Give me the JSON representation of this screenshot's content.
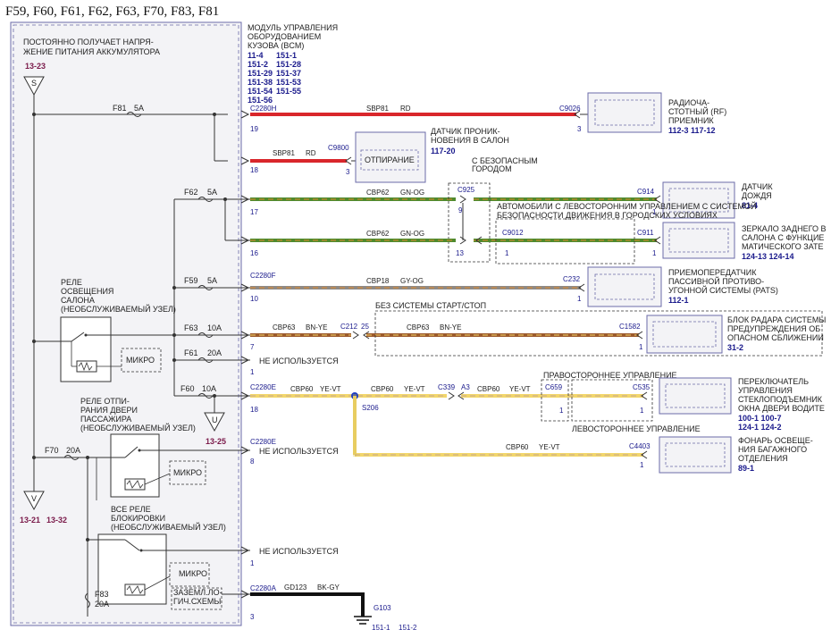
{
  "title": "F59, F60, F61, F62, F63, F70, F83, F81",
  "battery_note": "ПОСТОЯННО ПОЛУЧАЕТ НАПРЯ-\nЖЕНИЕ ПИТАНИЯ АККУМУЛЯТОРА",
  "battery_ref": "13-23",
  "battery_symbol": "S",
  "bcm": {
    "label": "МОДУЛЬ УПРАВЛЕНИЯ\nОБОРУДОВАНИЕМ\nКУЗОВА (BCM)",
    "refs": [
      [
        "11-4",
        "151-1"
      ],
      [
        "151-2",
        "151-28"
      ],
      [
        "151-29",
        "151-37"
      ],
      [
        "151-38",
        "151-53"
      ],
      [
        "151-54",
        "151-55"
      ],
      [
        "151-56",
        ""
      ]
    ]
  },
  "fuses": {
    "f81": {
      "name": "F81",
      "amp": "5A"
    },
    "f62": {
      "name": "F62",
      "amp": "5A"
    },
    "f59": {
      "name": "F59",
      "amp": "5A"
    },
    "f63": {
      "name": "F63",
      "amp": "10A"
    },
    "f61": {
      "name": "F61",
      "amp": "20A"
    },
    "f60": {
      "name": "F60",
      "amp": "10A"
    },
    "f70": {
      "name": "F70",
      "amp": "20A"
    },
    "f83": {
      "name": "F83",
      "amp": "20A"
    }
  },
  "connectors": {
    "c2280h": "C2280H",
    "c2280f": "C2280F",
    "c2280e": "C2280E",
    "c2280e2": "C2280E",
    "c2280a": "C2280A",
    "c9026": "C9026",
    "c9800": "C9800",
    "c925": "C925",
    "c914": "C914",
    "c9012": "C9012",
    "c911": "C911",
    "c232": "C232",
    "c212": "C212",
    "c212pin": "25",
    "c1582": "C1582",
    "c339": "C339",
    "c339pin": "A3",
    "c659": "C659",
    "c535": "C535",
    "c4403": "C4403",
    "s206": "S206",
    "g103": "G103"
  },
  "pins": {
    "p19": "19",
    "p18": "18",
    "p17": "17",
    "p16": "16",
    "p10": "10",
    "p7": "7",
    "p1a": "1",
    "p18b": "18",
    "p8": "8",
    "p1b": "1",
    "p3": "3",
    "c9026": "3",
    "c9800": "3",
    "c925a": "9",
    "c925b": "13",
    "c9012": "1",
    "c914": "1",
    "c911": "1",
    "c232": "1",
    "c1582": "1",
    "c659": "1",
    "c535": "1",
    "c4403": "1"
  },
  "wires": {
    "w1": {
      "circuit": "SBP81",
      "color": "RD"
    },
    "w2": {
      "circuit": "SBP81",
      "color": "RD"
    },
    "w3": {
      "circuit": "CBP62",
      "color": "GN-OG"
    },
    "w4": {
      "circuit": "CBP62",
      "color": "GN-OG"
    },
    "w5": {
      "circuit": "CBP18",
      "color": "GY-OG"
    },
    "w6a": {
      "circuit": "CBP63",
      "color": "BN-YE"
    },
    "w6b": {
      "circuit": "CBP63",
      "color": "BN-YE"
    },
    "w7a": {
      "circuit": "CBP60",
      "color": "YE-VT"
    },
    "w7b": {
      "circuit": "CBP60",
      "color": "YE-VT"
    },
    "w7c": {
      "circuit": "CBP60",
      "color": "YE-VT"
    },
    "w8": {
      "circuit": "CBP60",
      "color": "YE-VT"
    },
    "w9": {
      "circuit": "GD123",
      "color": "BK-GY"
    }
  },
  "not_used": "НЕ ИСПОЛЬЗУЕТСЯ",
  "unlock": "ОТПИРАНИЕ",
  "micro": "МИКРО",
  "ground_logic": "ЗАЗЕМЛ.ЛО-\nГИЧ.СХЕМЫ",
  "ground_refs": [
    "151-1",
    "151-2"
  ],
  "relays": {
    "interior": "РЕЛЕ\nОСВЕЩЕНИЯ\nСАЛОНА\n(НЕОБСЛУЖИВАЕМЫЙ УЗЕЛ)",
    "passenger": "РЕЛЕ ОТПИ-\nРАНИЯ ДВЕРИ\nПАССАЖИРА\n(НЕОБСЛУЖИВАЕМЫЙ УЗЕЛ)",
    "lock": "ВСЕ РЕЛЕ\nБЛОКИРОВКИ\n(НЕОБСЛУЖИВАЕМЫЙ УЗЕЛ)"
  },
  "u_symbol": "U",
  "u_ref": "13-25",
  "v_symbol": "V",
  "v_refs": [
    "13-21",
    "13-32"
  ],
  "notes": {
    "intrusion": "ДАТЧИК ПРОНИК-\nНОВЕНИЯ В САЛОН",
    "intrusion_ref": "117-20",
    "city_safety": "С БЕЗОПАСНЫМ\nГОРОДОМ",
    "lhd_city": "АВТОМОБИЛИ С ЛЕВОСТОРОННИМ УПРАВЛЕНИЕМ С СИСТЕМОЙ\nБЕЗОПАСНОСТИ ДВИЖЕНИЯ В ГОРОДСКИХ УСЛОВИЯХ",
    "no_start_stop": "БЕЗ СИСТЕМЫ СТАРТ/СТОП",
    "rhd": "ПРАВОСТОРОННЕЕ УПРАВЛЕНИЕ",
    "lhd": "ЛЕВОСТОРОННЕЕ УПРАВЛЕНИЕ"
  },
  "components": {
    "rf": {
      "label": "РАДИОЧА-\nСТОТНЫЙ (RF)\nПРИЕМНИК",
      "refs": "112-3    117-12"
    },
    "rain": {
      "label": "ДАТЧИК\nДОЖДЯ",
      "refs": "81-4"
    },
    "mirror": {
      "label": "ЗЕРКАЛО ЗАДНЕГО В\nСАЛОНА С ФУНКЦИЕ\nМАТИЧЕСКОГО ЗАТЕ",
      "refs": "124-13    124-14"
    },
    "pats": {
      "label": "ПРИЕМОПЕРЕДАТЧИК\nПАССИВНОЙ ПРОТИВО-\nУГОННОЙ СИСТЕМЫ (PATS)",
      "refs": "112-1"
    },
    "radar": {
      "label": "БЛОК РАДАРА СИСТЕМЫ\nПРЕДУПРЕЖДЕНИЯ ОБ\nОПАСНОМ СБЛИЖЕНИИ",
      "refs": "31-2"
    },
    "window": {
      "label": "ПЕРЕКЛЮЧАТЕЛЬ\nУПРАВЛЕНИЯ\nСТЕКЛОПОДЪЕМНИК\nОКНА ДВЕРИ ВОДИТЕ",
      "refs": "100-1    100-7\n124-1    124-2"
    },
    "trunk": {
      "label": "ФОНАРЬ ОСВЕЩЕ-\nНИЯ БАГАЖНОГО\nОТДЕЛЕНИЯ",
      "refs": "89-1"
    }
  },
  "colors": {
    "red": "#d9262b",
    "green": "#4f8a2e",
    "green_stripe": "#e08a2a",
    "gray": "#8f8a86",
    "brown": "#9c5a2c",
    "yellow": "#f2d66b",
    "black": "#111111",
    "blue_text": "#1a1a8c",
    "panel": "#f3f3f6",
    "panel_border": "#6b6ba8"
  }
}
